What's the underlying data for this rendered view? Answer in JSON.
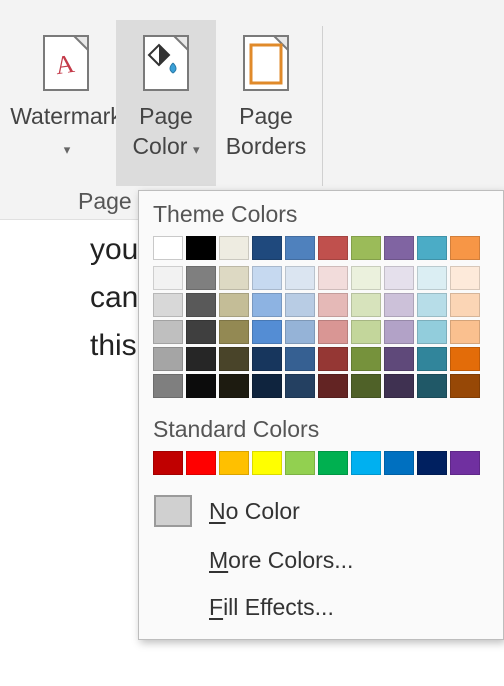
{
  "ribbon": {
    "watermark_label_1": "Watermark",
    "pagecolor_label_1": "Page",
    "pagecolor_label_2": "Color",
    "pageborders_label_1": "Page",
    "pageborders_label_2": "Borders",
    "group_label": "Page B"
  },
  "doc_lines": {
    "l1": "you",
    "l2": "can",
    "l3": "this"
  },
  "picker": {
    "theme_title": "Theme Colors",
    "std_title": "Standard Colors",
    "no_color": "o Color",
    "no_color_u": "N",
    "more_colors": "ore Colors...",
    "more_colors_u": "M",
    "fill_effects": "ill Effects...",
    "fill_effects_u": "F",
    "theme_row": [
      "#ffffff",
      "#000000",
      "#eeece1",
      "#1f497d",
      "#4f81bd",
      "#c0504d",
      "#9bbb59",
      "#8064a2",
      "#4bacc6",
      "#f79646"
    ],
    "shades": [
      [
        "#f2f2f2",
        "#7f7f7f",
        "#ddd9c3",
        "#c6d9f0",
        "#dbe5f1",
        "#f2dcdb",
        "#ebf1dd",
        "#e5e0ec",
        "#dbeef3",
        "#fdeada"
      ],
      [
        "#d8d8d8",
        "#595959",
        "#c4bd97",
        "#8db3e2",
        "#b8cce4",
        "#e5b9b7",
        "#d7e3bc",
        "#ccc1d9",
        "#b7dde8",
        "#fbd5b5"
      ],
      [
        "#bfbfbf",
        "#3f3f3f",
        "#938953",
        "#548dd4",
        "#95b3d7",
        "#d99694",
        "#c3d69b",
        "#b2a2c7",
        "#92cddc",
        "#fac08f"
      ],
      [
        "#a5a5a5",
        "#262626",
        "#494429",
        "#17365d",
        "#366092",
        "#953734",
        "#76923c",
        "#5f497a",
        "#31859b",
        "#e36c09"
      ],
      [
        "#7f7f7f",
        "#0c0c0c",
        "#1d1b10",
        "#0f243e",
        "#244061",
        "#632423",
        "#4f6128",
        "#3f3151",
        "#205867",
        "#974806"
      ]
    ],
    "standard_row": [
      "#c00000",
      "#ff0000",
      "#ffc000",
      "#ffff00",
      "#92d050",
      "#00b050",
      "#00b0f0",
      "#0070c0",
      "#002060",
      "#7030a0"
    ]
  }
}
